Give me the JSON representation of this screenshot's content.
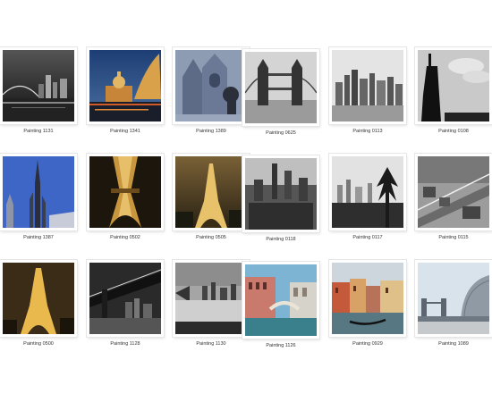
{
  "gallery": {
    "items": [
      {
        "caption": "Painting 1131",
        "scene": "bridge-night-skyline"
      },
      {
        "caption": "Painting 1341",
        "scene": "cathedral-dusk"
      },
      {
        "caption": "Painting 1389",
        "scene": "gothic-church-statue"
      },
      {
        "caption": "Painting 0625",
        "scene": "tower-bridge-bw"
      },
      {
        "caption": "Painting 0113",
        "scene": "manhattan-skyline-bw"
      },
      {
        "caption": "Painting 0108",
        "scene": "statue-of-liberty-silhouette"
      },
      {
        "caption": "Painting 1387",
        "scene": "gothic-spires-blue-sky"
      },
      {
        "caption": "Painting 0502",
        "scene": "eiffel-tower-lit-close"
      },
      {
        "caption": "Painting 0505",
        "scene": "eiffel-tower-dusk"
      },
      {
        "caption": "Painting 0118",
        "scene": "city-aerial-bw"
      },
      {
        "caption": "Painting 0117",
        "scene": "skyline-trees-bw"
      },
      {
        "caption": "Painting 0115",
        "scene": "brooklyn-aerial"
      },
      {
        "caption": "Painting 0500",
        "scene": "eiffel-tower-night"
      },
      {
        "caption": "Painting 1128",
        "scene": "brooklyn-bridge-night-bw"
      },
      {
        "caption": "Painting 1130",
        "scene": "skyline-water-bw"
      },
      {
        "caption": "Painting 1126",
        "scene": "venice-doges-palace"
      },
      {
        "caption": "Painting 0929",
        "scene": "venice-grand-canal-gondola"
      },
      {
        "caption": "Painting 1089",
        "scene": "tower-bridge-city-hall"
      }
    ]
  }
}
